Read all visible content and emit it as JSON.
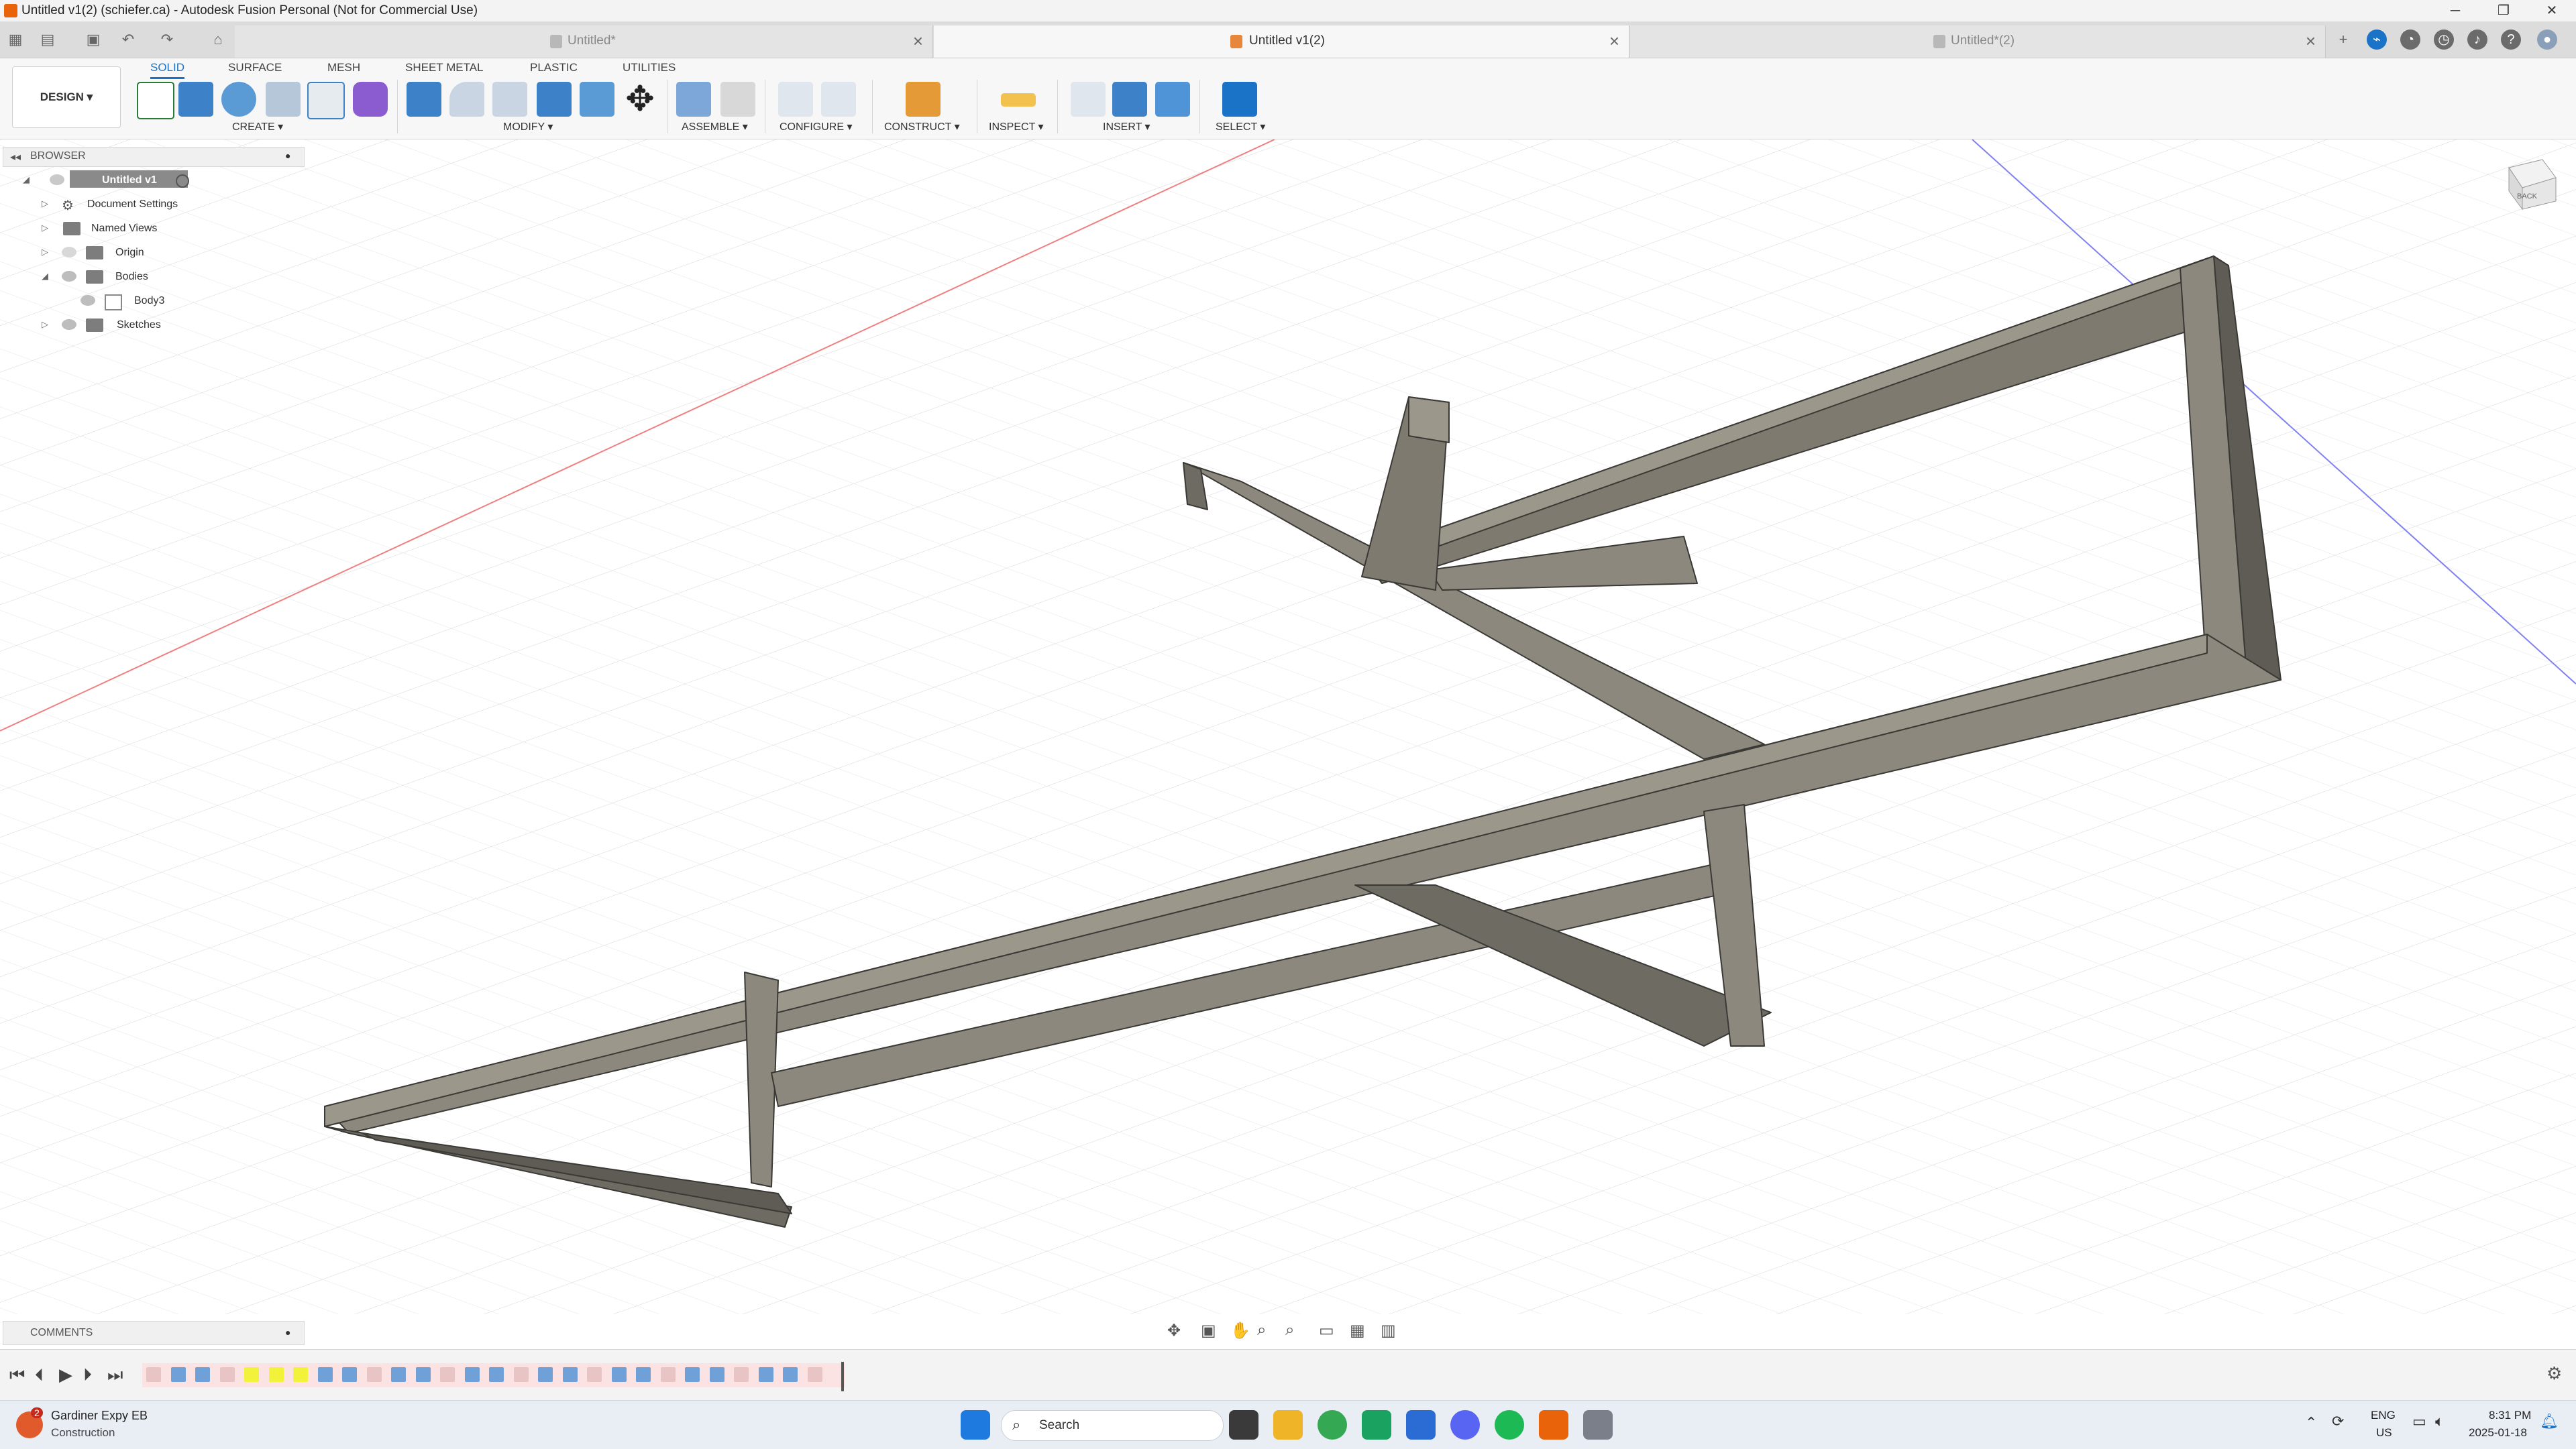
{
  "window": {
    "title": "Untitled v1(2) (schiefer.ca) - Autodesk Fusion Personal (Not for Commercial Use)",
    "controls": [
      "─",
      "❐",
      "✕"
    ]
  },
  "tabs": [
    {
      "label": "Untitled*",
      "active": false
    },
    {
      "label": "Untitled v1(2)",
      "active": true
    },
    {
      "label": "Untitled*(2)",
      "active": false
    }
  ],
  "ribbon": {
    "workspace": "DESIGN ▾",
    "tabs": [
      "SOLID",
      "SURFACE",
      "MESH",
      "SHEET METAL",
      "PLASTIC",
      "UTILITIES"
    ],
    "groups": [
      "CREATE ▾",
      "MODIFY ▾",
      "ASSEMBLE ▾",
      "CONFIGURE ▾",
      "CONSTRUCT ▾",
      "INSPECT ▾",
      "INSERT ▾",
      "SELECT ▾"
    ]
  },
  "browser": {
    "title": "BROWSER",
    "root": "Untitled v1",
    "items": [
      {
        "label": "Document Settings"
      },
      {
        "label": "Named Views"
      },
      {
        "label": "Origin"
      },
      {
        "label": "Bodies"
      },
      {
        "label": "Body3"
      },
      {
        "label": "Sketches"
      }
    ]
  },
  "comments": {
    "title": "COMMENTS"
  },
  "viewcube": {
    "face_label": "BACK"
  },
  "taskbar": {
    "weather_title": "Gardiner Expy EB",
    "weather_sub": "Construction",
    "weather_badge": "2",
    "search_placeholder": "Search",
    "lang": "ENG",
    "region": "US",
    "time": "8:31 PM",
    "date": "2025-01-18"
  },
  "colors": {
    "accent": "#1a73c7",
    "model_face_light": "#8c887d",
    "model_face_dark": "#5f5c55",
    "model_face_top": "#9b978b"
  }
}
